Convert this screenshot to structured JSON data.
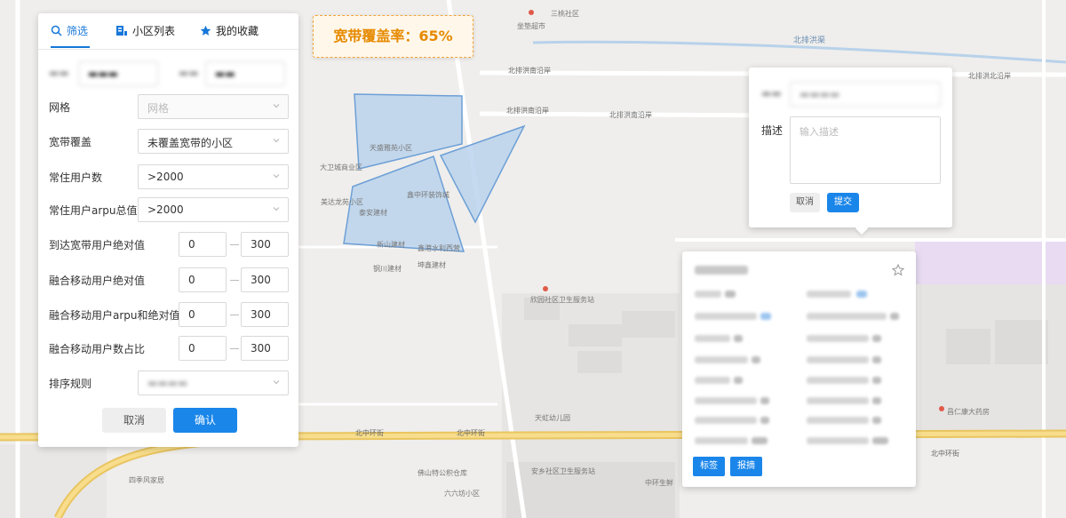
{
  "tabs": [
    {
      "label": "筛选",
      "icon": "search-icon",
      "active": true
    },
    {
      "label": "小区列表",
      "icon": "list-icon",
      "active": false
    },
    {
      "label": "我的收藏",
      "icon": "star-icon",
      "active": false
    }
  ],
  "filters": {
    "grid": {
      "label": "网格",
      "placeholder": "网格"
    },
    "broadband": {
      "label": "宽带覆盖",
      "value": "未覆盖宽带的小区"
    },
    "resident_users": {
      "label": "常住用户数",
      "value": ">2000"
    },
    "resident_arpu": {
      "label": "常住用户arpu总值",
      "value": ">2000"
    },
    "broadband_abs": {
      "label": "到达宽带用户绝对值",
      "min": "0",
      "max": "300"
    },
    "mobile_abs": {
      "label": "融合移动用户绝对值",
      "min": "0",
      "max": "300"
    },
    "mobile_arpu_abs": {
      "label": "融合移动用户arpu和绝对值",
      "min": "0",
      "max": "300"
    },
    "mobile_ratio": {
      "label": "融合移动用户数占比",
      "min": "0",
      "max": "300"
    },
    "sort": {
      "label": "排序规则"
    }
  },
  "actions": {
    "cancel": "取消",
    "confirm": "确认"
  },
  "coverage": {
    "text": "宽带覆盖率：65%"
  },
  "desc_popup": {
    "label": "描述",
    "placeholder": "输入描述",
    "cancel": "取消",
    "submit": "提交"
  },
  "info_card": {
    "tag_btn": "标签",
    "report_btn": "报摘"
  },
  "map_labels": {
    "road_north2": "北排洪渠",
    "road_north_cz": "北排洪南沿岸",
    "road_north_cz2": "北排洪南沿岸",
    "road_north_cz3": "北排洪南沿岸",
    "road_north_cz4": "北排洪北沿岸",
    "road_beizhong": "北中环街",
    "road_beizhong2": "北中环街",
    "road_beizhong3": "北中环街",
    "poi1": "天盛雅苑小区",
    "poi2": "大卫城商业区",
    "poi3": "美达龙苑小区",
    "poi4": "泰安建材",
    "poi5": "鑫中环装饰城",
    "poi6": "新山建材",
    "poi7": "鑫港水利西营",
    "poi8": "钢川建材",
    "poi9": "坤鑫建材",
    "poi10": "欣园社区卫生服务站",
    "poi11": "天虹幼儿园",
    "poi12": "佛山特公积仓库",
    "poi13": "六六坊小区",
    "poi14": "四季风家居",
    "poi15": "安乡社区卫生服务站",
    "poi16": "中环生鲜",
    "poi17": "昌仁康大药房",
    "poi18": "三桃社区",
    "poi19": "坐垫超市"
  }
}
